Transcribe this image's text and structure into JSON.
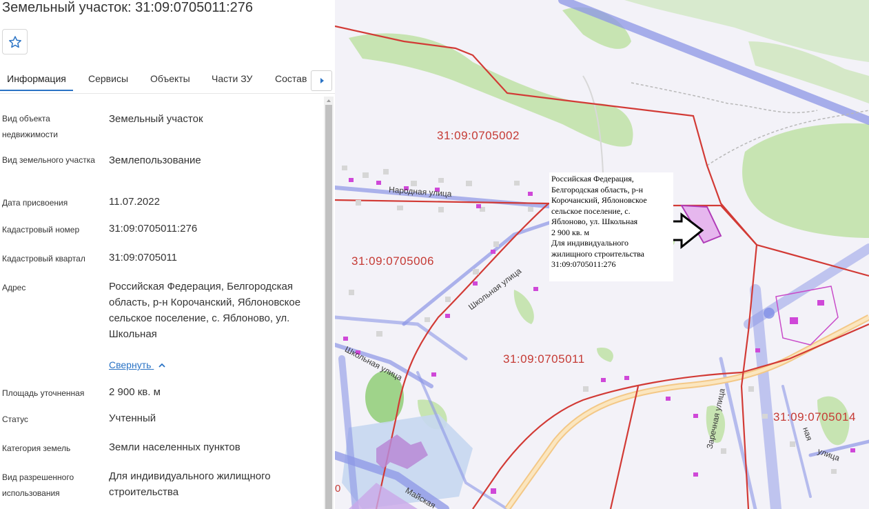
{
  "header": {
    "title": "Земельный участок: 31:09:0705011:276"
  },
  "tabs": [
    {
      "label": "Информация"
    },
    {
      "label": "Сервисы"
    },
    {
      "label": "Объекты"
    },
    {
      "label": "Части ЗУ"
    },
    {
      "label": "Состав"
    }
  ],
  "info": {
    "rows": [
      {
        "label": "Вид объекта недвижимости",
        "value": "Земельный участок"
      },
      {
        "label": "Вид земельного участка",
        "value": "Землепользование"
      },
      {
        "label": "Дата присвоения",
        "value": "11.07.2022"
      },
      {
        "label": "Кадастровый номер",
        "value": "31:09:0705011:276"
      },
      {
        "label": "Кадастровый квартал",
        "value": "31:09:0705011"
      },
      {
        "label": "Адрес",
        "value": "Российская Федерация, Белгородская область, р-н Корочанский, Яблоновское сельское поселение, с. Яблоново, ул. Школьная"
      },
      {
        "label": "Площадь уточненная",
        "value": "2 900 кв. м"
      },
      {
        "label": "Статус",
        "value": "Учтенный"
      },
      {
        "label": "Категория земель",
        "value": "Земли населенных пунктов"
      },
      {
        "label": "Вид разрешенного использования",
        "value": "Для индивидуального жилищного строительства"
      }
    ],
    "collapse_label": "Свернуть"
  },
  "map": {
    "quarters": [
      "31:09:0705002",
      "31:09:0705006",
      "31:09:0705011",
      "31:09:0705014"
    ],
    "streets": [
      "Народная улица",
      "Школьная улица",
      "Школьная улица",
      "Заречная улица",
      "улица",
      "Майская",
      "ная"
    ],
    "stray_digit": "0",
    "popup": {
      "lines": [
        "Российская Федерация,",
        "Белгородская область, р-н",
        "Корочанский, Яблоновское",
        "сельское поселение, с.",
        "Яблоново, ул. Школьная",
        "2 900 кв. м",
        "Для индивидуального",
        "жилищного строительства",
        "31:09:0705011:276"
      ]
    },
    "colors": {
      "boundary": "#d23a35",
      "road": "#8c96e6",
      "green": "#bfe0a8",
      "parcel": "#e6b7ee"
    }
  },
  "icons": {
    "favorite": "star-icon",
    "tabs_next": "arrow-right-icon",
    "collapse": "chevron-up-icon",
    "pointer": "arrow-pointer-icon"
  }
}
